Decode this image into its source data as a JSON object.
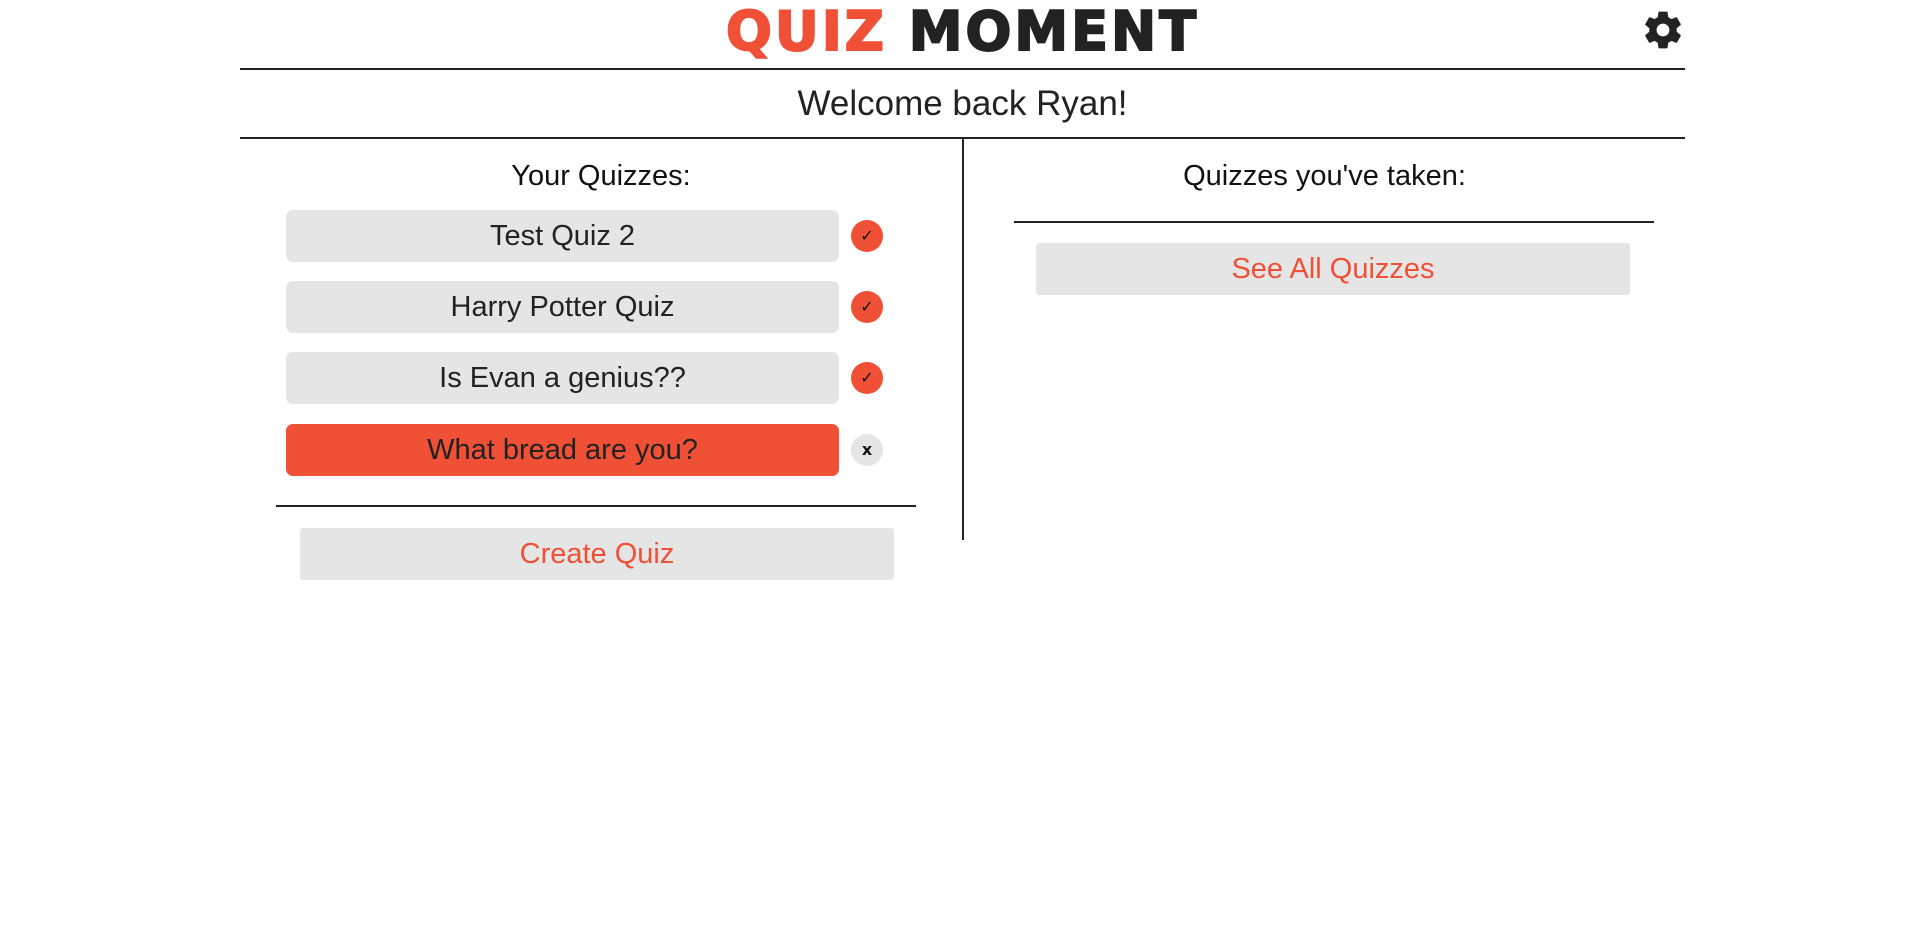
{
  "header": {
    "logo_word1": "QUIZ",
    "logo_word2": "MOMENT",
    "settings_icon": "gear-icon"
  },
  "welcome": {
    "text": "Welcome back Ryan!"
  },
  "my_quizzes": {
    "heading": "Your Quizzes:",
    "items": [
      {
        "title": "Test Quiz 2",
        "status_symbol": "✓",
        "status": "published",
        "selected": false
      },
      {
        "title": "Harry Potter Quiz",
        "status_symbol": "✓",
        "status": "published",
        "selected": false
      },
      {
        "title": "Is Evan a genius??",
        "status_symbol": "✓",
        "status": "published",
        "selected": false
      },
      {
        "title": "What bread are you?",
        "status_symbol": "x",
        "status": "unpublished",
        "selected": true
      }
    ],
    "create_label": "Create Quiz"
  },
  "taken_quizzes": {
    "heading": "Quizzes you've taken:",
    "see_all_label": "See All Quizzes"
  },
  "colors": {
    "accent": "#ef5036",
    "button_bg": "#e5e5e5",
    "text": "#222222"
  }
}
